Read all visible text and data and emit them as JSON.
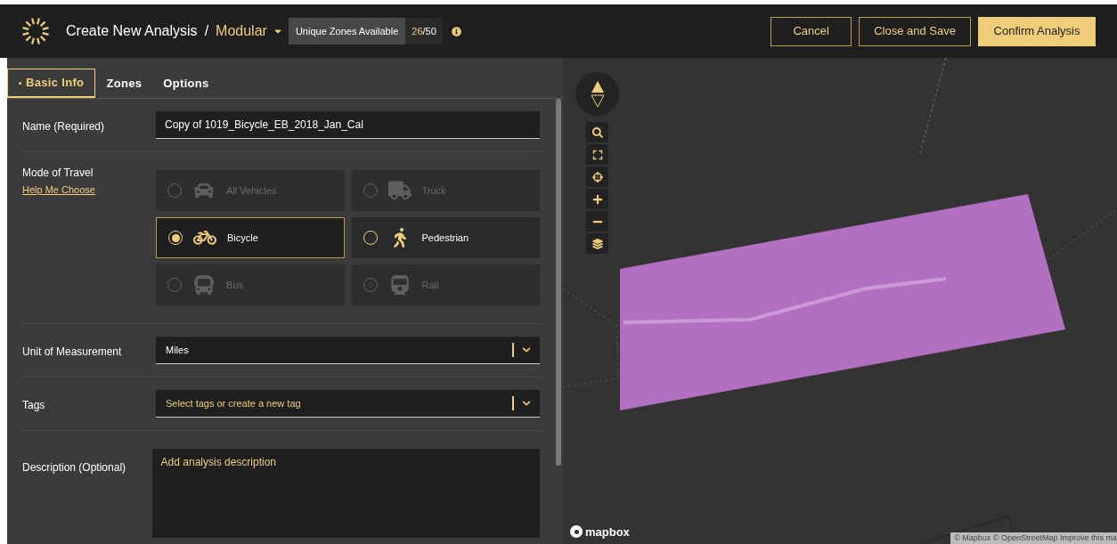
{
  "header": {
    "title": "Create New Analysis",
    "separator": "/",
    "type": "Modular",
    "zones_label": "Unique Zones Available",
    "zones_used": "26",
    "zones_total": "/50",
    "buttons": [
      {
        "label": "Cancel",
        "kind": "outline"
      },
      {
        "label": "Close and Save",
        "kind": "outline"
      },
      {
        "label": "Confirm Analysis",
        "kind": "primary"
      }
    ]
  },
  "tabs": [
    {
      "label": "Basic Info",
      "selected": true
    },
    {
      "label": "Zones",
      "selected": false
    },
    {
      "label": "Options",
      "selected": false
    }
  ],
  "form": {
    "name": {
      "label": "Name (Required)",
      "value": "Copy of 1019_Bicycle_EB_2018_Jan_Cal"
    },
    "mode": {
      "label": "Mode of Travel",
      "help": "Help Me Choose",
      "options": [
        {
          "label": "All Vehicles",
          "kind": "car",
          "selected": false,
          "disabled": true
        },
        {
          "label": "Truck",
          "kind": "truck",
          "selected": false,
          "disabled": true
        },
        {
          "label": "Bicycle",
          "kind": "bicycle",
          "selected": true,
          "disabled": false
        },
        {
          "label": "Pedestrian",
          "kind": "pedestrian",
          "selected": false,
          "disabled": false
        },
        {
          "label": "Bus",
          "kind": "bus",
          "selected": false,
          "disabled": true
        },
        {
          "label": "Rail",
          "kind": "rail",
          "selected": false,
          "disabled": true
        }
      ]
    },
    "unit": {
      "label": "Unit of Measurement",
      "value": "Miles"
    },
    "tags": {
      "label": "Tags",
      "placeholder": "Select tags or create a new tag"
    },
    "description": {
      "label": "Description (Optional)",
      "placeholder": "Add analysis description"
    }
  },
  "map": {
    "logo": "mapbox",
    "attribution": "© Mapbox © OpenStreetMap Improve this ma"
  }
}
